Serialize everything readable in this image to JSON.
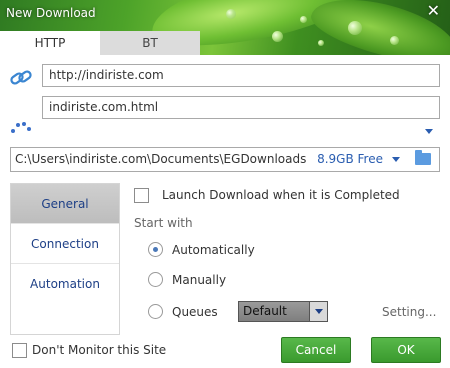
{
  "window": {
    "title": "New Download",
    "close_glyph": "✕"
  },
  "tabs": [
    {
      "label": "HTTP",
      "active": true
    },
    {
      "label": "BT",
      "active": false
    }
  ],
  "url_field": {
    "value": "http://indiriste.com"
  },
  "filename_field": {
    "value": "indiriste.com.html"
  },
  "save_path": {
    "value": "C:\\Users\\indiriste.com\\Documents\\EGDownloads",
    "free_space": "8.9GB Free"
  },
  "sidebar": {
    "items": [
      {
        "label": "General",
        "active": true
      },
      {
        "label": "Connection",
        "active": false
      },
      {
        "label": "Automation",
        "active": false
      }
    ]
  },
  "general": {
    "launch_label": "Launch Download when it is Completed",
    "start_with_label": "Start with",
    "options": [
      {
        "label": "Automatically",
        "selected": true
      },
      {
        "label": "Manually",
        "selected": false
      },
      {
        "label": "Queues",
        "selected": false
      }
    ],
    "queue_select": {
      "value": "Default"
    },
    "setting_link": "Setting..."
  },
  "footer": {
    "monitor_label": "Don't Monitor this Site",
    "cancel_label": "Cancel",
    "ok_label": "OK"
  },
  "colors": {
    "accent_green": "#3a9a2e",
    "link_blue": "#2a5db0",
    "sidebar_text": "#1d3f86"
  },
  "icons": {
    "link": "link-icon",
    "dots": "dots-icon",
    "folder": "folder-icon",
    "dropdown": "chevron-down-icon"
  }
}
